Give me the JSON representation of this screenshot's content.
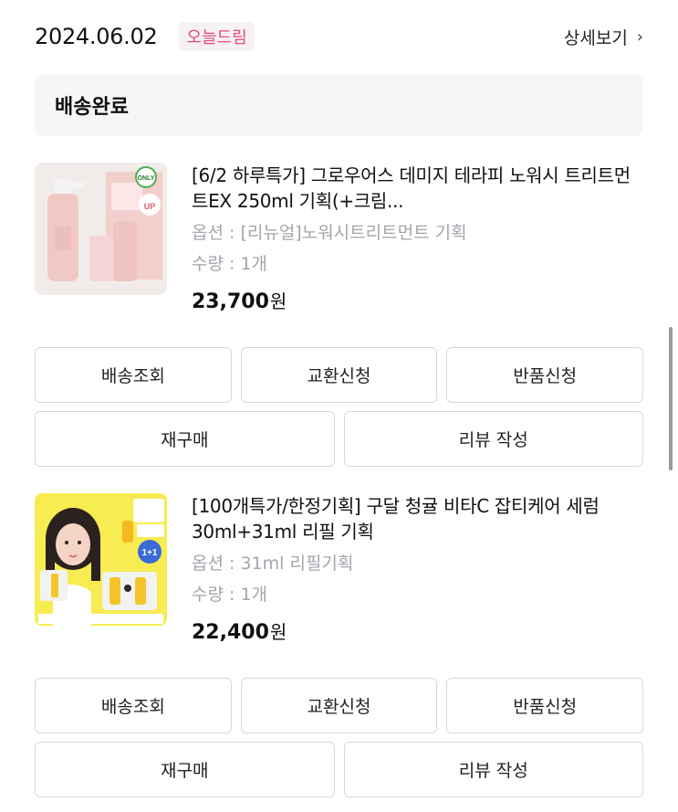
{
  "order": {
    "date": "2024.06.02",
    "badge": "오늘드림",
    "detail_label": "상세보기",
    "status": "배송완료"
  },
  "products": [
    {
      "name": "[6/2 하루특가] 그로우어스 데미지 테라피 노워시 트리트먼트EX 250ml 기획(+크림...",
      "option": "옵션 : [리뉴얼]노워시트리트먼트 기획",
      "quantity": "수량 : 1개",
      "price": "23,700",
      "currency": "원",
      "image": "pink-hair-treatment-bottles",
      "colors": {
        "bg": "#f1ecea",
        "bottle": "#f3d2cf",
        "label": "#ffffff",
        "accent": "#e55a6f"
      }
    },
    {
      "name": "[100개특가/한정기획] 구달 청귤 비타C 잡티케어 세럼 30ml+31ml 리필 기획",
      "option": "옵션 : 31ml 리필기획",
      "quantity": "수량 : 1개",
      "price": "22,400",
      "currency": "원",
      "image": "yellow-vitamin-serum-ad",
      "colors": {
        "bg": "#f7ec52",
        "accent": "#3a6ad6"
      }
    }
  ],
  "actions": {
    "track": "배송조회",
    "exchange": "교환신청",
    "return": "반품신청",
    "reorder": "재구매",
    "review": "리뷰 작성"
  }
}
